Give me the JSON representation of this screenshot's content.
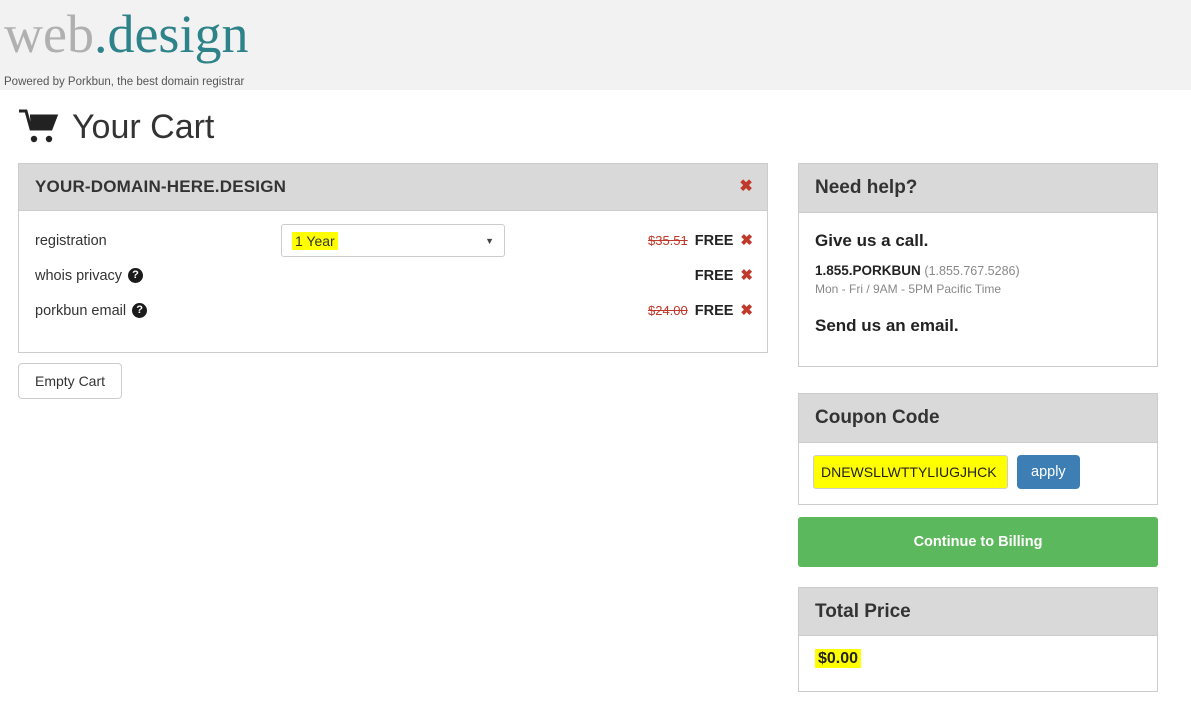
{
  "header": {
    "logo_primary": "web",
    "logo_dot": ".",
    "logo_tld": "design",
    "tagline": "Powered by Porkbun, the best domain registrar"
  },
  "page": {
    "title": "Your Cart",
    "cart_icon": "shopping-cart-icon"
  },
  "cart": {
    "domain": "YOUR-DOMAIN-HERE.DESIGN",
    "remove_domain_icon": "✖",
    "rows": [
      {
        "label": "registration",
        "has_help": false,
        "help_icon": "?",
        "control": "select",
        "select_value": "1 Year",
        "caret_icon": "▼",
        "price_old": "$35.51",
        "price_new": "FREE",
        "remove_icon": "✖"
      },
      {
        "label": "whois privacy",
        "has_help": true,
        "help_icon": "?",
        "control": "none",
        "price_old": "",
        "price_new": "FREE",
        "remove_icon": "✖"
      },
      {
        "label": "porkbun email",
        "has_help": true,
        "help_icon": "?",
        "control": "none",
        "price_old": "$24.00",
        "price_new": "FREE",
        "remove_icon": "✖"
      }
    ],
    "empty_cart_label": "Empty Cart"
  },
  "help": {
    "title": "Need help?",
    "call_heading": "Give us a call.",
    "phone_word": "1.855.PORKBUN",
    "phone_number": "(1.855.767.5286)",
    "hours": "Mon - Fri / 9AM - 5PM Pacific Time",
    "email_heading": "Send us an email."
  },
  "coupon": {
    "title": "Coupon Code",
    "value": "DNEWSLLWTTYLIUGJHCK",
    "placeholder": "Coupon Code",
    "apply_label": "apply"
  },
  "checkout": {
    "continue_label": "Continue to Billing"
  },
  "total": {
    "title": "Total Price",
    "value": "$0.00"
  },
  "colors": {
    "brand_teal": "#2e8289",
    "logo_gray": "#b0b0b0",
    "panel_header": "#d9d9d9",
    "accent_green": "#5cb85c",
    "accent_blue": "#3d7eb5",
    "danger_red": "#c0392b",
    "highlight_yellow": "#ffff00"
  }
}
